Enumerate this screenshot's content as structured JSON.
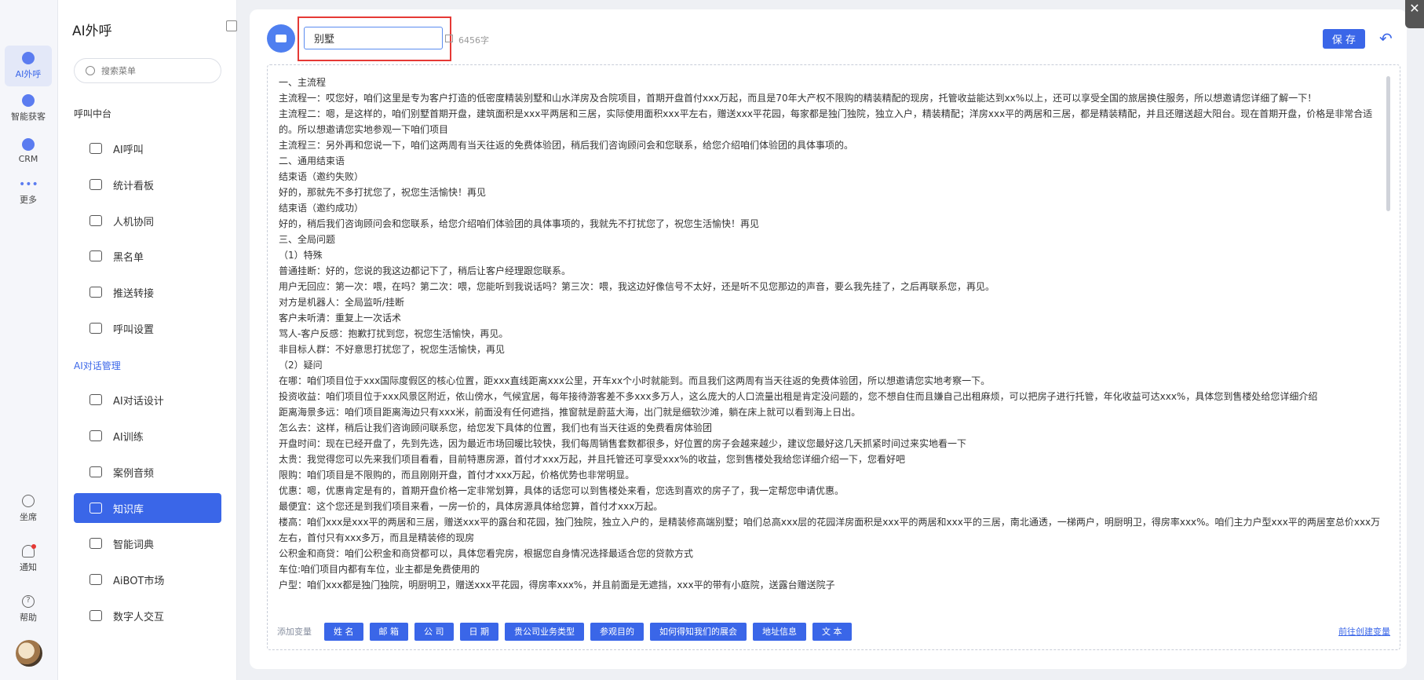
{
  "rail": {
    "items": [
      {
        "label": "AI外呼"
      },
      {
        "label": "智能获客"
      },
      {
        "label": "CRM"
      },
      {
        "label": "更多"
      }
    ],
    "bottom": [
      {
        "label": "坐席"
      },
      {
        "label": "通知"
      },
      {
        "label": "帮助"
      }
    ]
  },
  "menu": {
    "title": "AI外呼",
    "search_placeholder": "搜索菜单",
    "group1": "呼叫中台",
    "group1_items": [
      "AI呼叫",
      "统计看板",
      "人机协同",
      "黑名单",
      "推送转接",
      "呼叫设置"
    ],
    "group2": "AI对话管理",
    "group2_items": [
      "AI对话设计",
      "AI训练",
      "案例音频",
      "知识库",
      "智能词典",
      "AiBOT市场",
      "数字人交互"
    ]
  },
  "editor": {
    "name_value": "别墅",
    "char_count": "6456字",
    "save_label": "保 存",
    "lines": [
      "一、主流程",
      "主流程一：哎您好，咱们这里是专为客户打造的低密度精装别墅和山水洋房及合院项目，首期开盘首付xxx万起，而且是70年大产权不限购的精装精配的现房，托管收益能达到xx%以上，还可以享受全国的旅居换住服务，所以想邀请您详细了解一下！",
      "主流程二：嗯，是这样的，咱们别墅首期开盘，建筑面积是xxx平两居和三居，实际使用面积xxx平左右，赠送xxx平花园，每家都是独门独院，独立入户，精装精配；洋房xxx平的两居和三居，都是精装精配，并且还赠送超大阳台。现在首期开盘，价格是非常合适的。所以想邀请您实地参观一下咱们项目",
      "主流程三：另外再和您说一下，咱们这两周有当天往返的免费体验团，稍后我们咨询顾问会和您联系，给您介绍咱们体验团的具体事项的。",
      "二、通用结束语",
      "结束语（邀约失败）",
      "好的，那就先不多打扰您了，祝您生活愉快！再见",
      "结束语（邀约成功）",
      "好的，稍后我们咨询顾问会和您联系，给您介绍咱们体验团的具体事项的，我就先不打扰您了，祝您生活愉快！再见",
      "三、全局问题",
      "（1）特殊",
      "普通挂断：好的，您说的我这边都记下了，稍后让客户经理跟您联系。",
      "用户无回应：第一次：喂，在吗？第二次：喂，您能听到我说话吗？第三次：喂，我这边好像信号不太好，还是听不见您那边的声音，要么我先挂了，之后再联系您，再见。",
      "对方是机器人：全局监听/挂断",
      "客户未听清：重复上一次话术",
      "骂人-客户反感：抱歉打扰到您，祝您生活愉快，再见。",
      "非目标人群：不好意思打扰您了，祝您生活愉快，再见",
      "（2）疑问",
      "在哪：咱们项目位于xxx国际度假区的核心位置，距xxx直线距离xxx公里，开车xx个小时就能到。而且我们这两周有当天往返的免费体验团，所以想邀请您实地考察一下。",
      "投资收益：咱们项目位于xxx风景区附近，依山傍水，气候宜居，每年接待游客差不多xxx多万人，这么庞大的人口流量出租是肯定没问题的，您不想自住而且嫌自己出租麻烦，可以把房子进行托管，年化收益可达xxx%，具体您到售楼处给您详细介绍",
      "距离海景多远：咱们项目距离海边只有xxx米，前面没有任何遮挡，推窗就是蔚蓝大海，出门就是细软沙滩，躺在床上就可以看到海上日出。",
      "怎么去：这样，稍后让我们咨询顾问联系您，给您发下具体的位置，我们也有当天往返的免费看房体验团",
      "开盘时间：现在已经开盘了，先到先选，因为最近市场回暖比较快，我们每周销售套数都很多，好位置的房子会越来越少，建议您最好这几天抓紧时间过来实地看一下",
      "太贵：我觉得您可以先来我们项目看看，目前特惠房源，首付才xxx万起，并且托管还可享受xxx%的收益，您到售楼处我给您详细介绍一下，您看好吧",
      "限购：咱们项目是不限购的，而且刚刚开盘，首付才xxx万起，价格优势也非常明显。",
      "优惠：嗯，优惠肯定是有的，首期开盘价格一定非常划算，具体的话您可以到售楼处来看，您选到喜欢的房子了，我一定帮您申请优惠。",
      "最便宜：这个您还是到我们项目来看，一房一价的，具体房源具体给您算，首付才xxx万起。",
      "楼高：咱们xxx是xxx平的两居和三居，赠送xxx平的露台和花园，独门独院，独立入户的，是精装修高端别墅；咱们总高xxx层的花园洋房面积是xxx平的两居和xxx平的三居，南北通透，一梯两户，明厨明卫，得房率xxx%。咱们主力户型xxx平的两居室总价xxx万左右，首付只有xxx多万，而且是精装修的现房",
      "公积金和商贷：咱们公积金和商贷都可以，具体您看完房，根据您自身情况选择最适合您的贷款方式",
      "车位:咱们项目内都有车位，业主都是免费使用的",
      "户型：咱们xxx都是独门独院，明厨明卫，赠送xxx平花园，得房率xxx%，并且前面是无遮挡，xxx平的带有小庭院，送露台赠送院子"
    ],
    "var_label": "添加变量",
    "variables": [
      "姓 名",
      "邮 箱",
      "公 司",
      "日 期",
      "贵公司业务类型",
      "参观目的",
      "如何得知我们的展会",
      "地址信息",
      "文 本"
    ],
    "create_link": "前往创建变量"
  }
}
